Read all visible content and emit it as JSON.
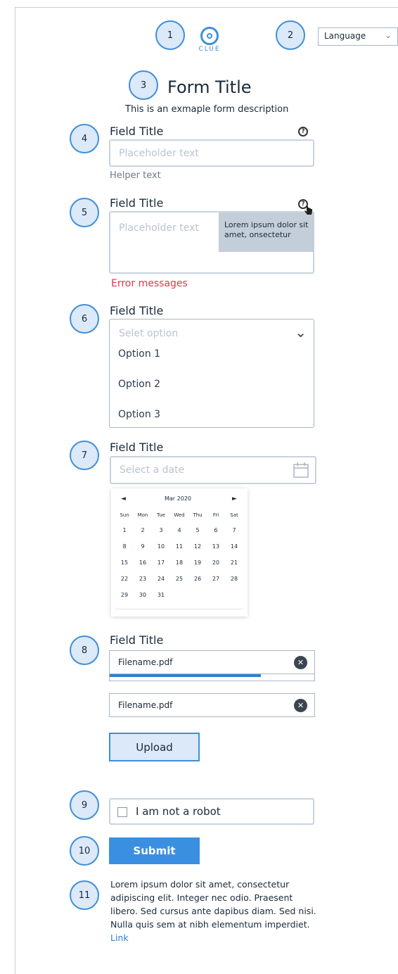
{
  "header": {
    "logo_text": "CLUE",
    "language_label": "Language",
    "form_title": "Form Title",
    "form_description": "This is an exmaple form description"
  },
  "badges": [
    "1",
    "2",
    "3",
    "4",
    "5",
    "6",
    "7",
    "8",
    "9",
    "10",
    "11"
  ],
  "field_text": {
    "title": "Field Title",
    "placeholder": "Placeholder text",
    "helper": "Helper text"
  },
  "field_textarea": {
    "title": "Field Title",
    "placeholder": "Placeholder text",
    "tooltip": "Lorem ipsum dolor sit amet, onsectetur",
    "error": "Error messages"
  },
  "field_select": {
    "title": "Field Title",
    "placeholder": "Selet option",
    "options": [
      "Option 1",
      "Option 2",
      "Option 3"
    ]
  },
  "field_date": {
    "title": "Field Title",
    "placeholder": "Select a date",
    "calendar": {
      "month_label": "Mar 2020",
      "prev": "◄",
      "next": "►",
      "weekdays": [
        "Sun",
        "Mon",
        "Tue",
        "Wed",
        "Thu",
        "Fri",
        "Sat"
      ],
      "weeks": [
        [
          "1",
          "2",
          "3",
          "4",
          "5",
          "6",
          "7"
        ],
        [
          "8",
          "9",
          "10",
          "11",
          "12",
          "13",
          "14"
        ],
        [
          "15",
          "16",
          "17",
          "18",
          "19",
          "20",
          "21"
        ],
        [
          "22",
          "23",
          "24",
          "25",
          "26",
          "27",
          "28"
        ],
        [
          "29",
          "30",
          "31",
          "",
          "",
          "",
          ""
        ]
      ]
    }
  },
  "field_upload": {
    "title": "Field Title",
    "files": [
      {
        "name": "Filename.pdf",
        "progress": 0.74
      },
      {
        "name": "Filename.pdf"
      }
    ],
    "upload_label": "Upload"
  },
  "captcha": {
    "label": "I am not a robot"
  },
  "submit_label": "Submit",
  "footer": {
    "text": "Lorem ipsum dolor sit amet, consectetur adipiscing elit. Integer nec odio. Praesent libero. Sed cursus ante dapibus diam. Sed nisi. Nulla quis sem at nibh elementum imperdiet.",
    "link": "Link"
  },
  "colors": {
    "accent": "#3f8fd8",
    "badge_fill": "#dbe9f8",
    "error": "#e0364a",
    "submit": "#3b8fe0",
    "tooltip_bg": "#c4ced8"
  }
}
